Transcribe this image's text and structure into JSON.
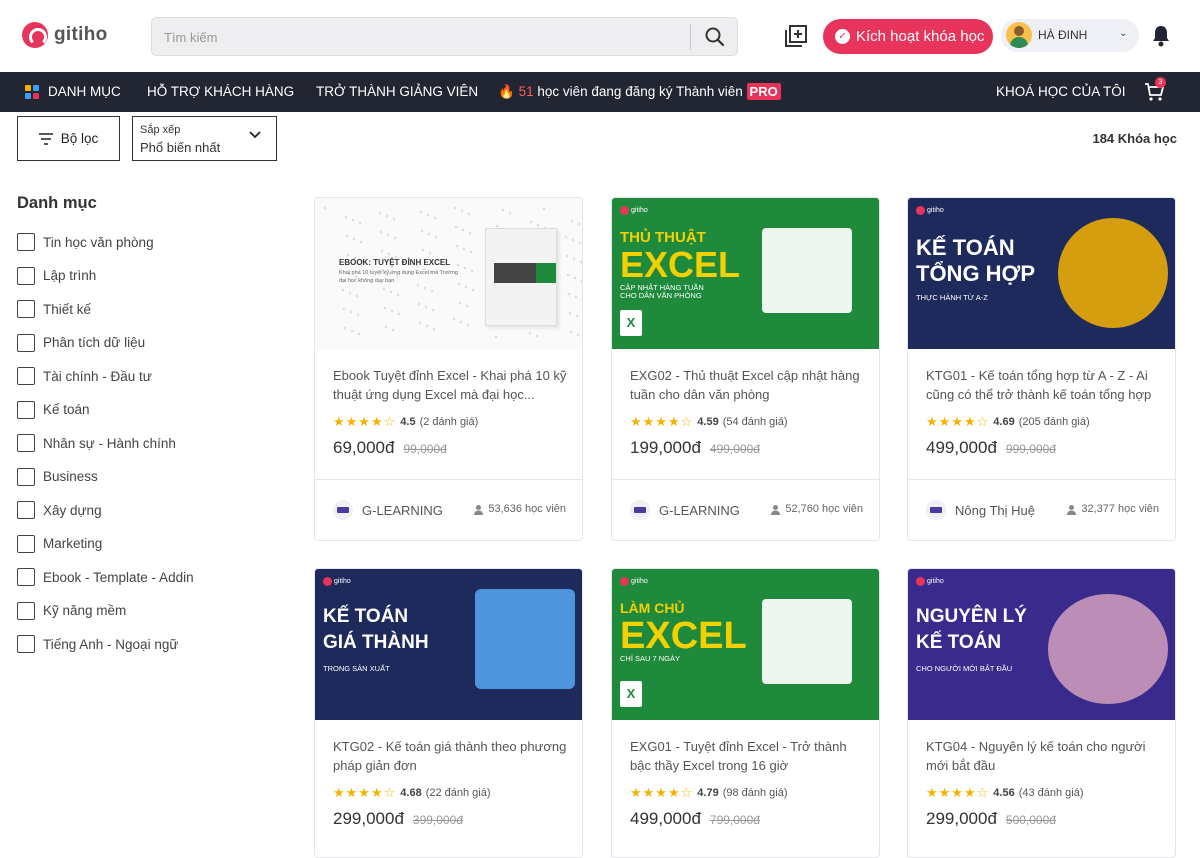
{
  "header": {
    "logo_text": "gitiho",
    "search_placeholder": "Tìm kiếm",
    "activate_label": "Kích hoạt khóa học",
    "user_name": "HÀ ĐINH"
  },
  "nav": {
    "category": "DANH MỤC",
    "support": "HỖ TRỢ KHÁCH HÀNG",
    "teacher": "TRỞ THÀNH GIẢNG VIÊN",
    "promo_count": "51",
    "promo_text": "học viên đang đăng ký Thành viên",
    "promo_badge": "PRO",
    "my_courses": "KHOÁ HỌC CỦA TÔI",
    "cart_count": "3"
  },
  "filters": {
    "filter_label": "Bộ lọc",
    "sort_label": "Sắp xếp",
    "sort_value": "Phổ biến nhất",
    "total": "184 Khóa học"
  },
  "sidebar": {
    "title": "Danh mục",
    "items": [
      "Tin học văn phòng",
      "Lập trình",
      "Thiết kế",
      "Phân tích dữ liệu",
      "Tài chính - Đầu tư",
      "Kế toán",
      "Nhân sự - Hành chính",
      "Business",
      "Xây dựng",
      "Marketing",
      "Ebook - Template - Addin",
      "Kỹ năng mềm",
      "Tiếng Anh - Ngoại ngữ"
    ]
  },
  "courses": [
    {
      "title": "Ebook Tuyệt đỉnh Excel - Khai phá 10 kỹ thuật ứng dụng Excel mà đại học...",
      "rating": "4.5",
      "reviews": "(2 đánh giá)",
      "price": "69,000đ",
      "old_price": "99,000đ",
      "author": "G-LEARNING",
      "students": "53,636 học viên",
      "thumb_line1": "EBOOK: TUYỆT ĐỈNH EXCEL",
      "thumb_line2": "Khai phá 10 tuyệt kỹ ứng dụng Excel mà Trường đại học không dạy bạn"
    },
    {
      "title": "EXG02 - Thủ thuật Excel cập nhật hàng tuần cho dân văn phòng",
      "rating": "4.59",
      "reviews": "(54 đánh giá)",
      "price": "199,000đ",
      "old_price": "499,000đ",
      "author": "G-LEARNING",
      "students": "52,760 học viên",
      "thumb_line1": "THỦ THUẬT",
      "thumb_line2": "EXCEL",
      "thumb_line3": "CẬP NHẬT HÀNG TUẦN CHO DÂN VĂN PHÒNG"
    },
    {
      "title": "KTG01 - Kế toán tổng hợp từ A - Z - Ai cũng có thể trở thành kế toán tổng hợp",
      "rating": "4.69",
      "reviews": "(205 đánh giá)",
      "price": "499,000đ",
      "old_price": "999,000đ",
      "author": "Nông Thị Huệ",
      "students": "32,377 học viên",
      "thumb_line1": "KẾ TOÁN",
      "thumb_line2": "TỔNG HỢP",
      "thumb_line3": "THỰC HÀNH TỪ A-Z"
    },
    {
      "title": "KTG02 - Kế toán giá thành theo phương pháp giản đơn",
      "rating": "4.68",
      "reviews": "(22 đánh giá)",
      "price": "299,000đ",
      "old_price": "399,000đ",
      "thumb_line1": "KẾ TOÁN",
      "thumb_line2": "GIÁ THÀNH",
      "thumb_line3": "TRONG SẢN XUẤT"
    },
    {
      "title": "EXG01 - Tuyệt đỉnh Excel - Trở thành bậc thầy Excel trong 16 giờ",
      "rating": "4.79",
      "reviews": "(98 đánh giá)",
      "price": "499,000đ",
      "old_price": "799,000đ",
      "thumb_line1": "LÀM CHỦ",
      "thumb_line2": "EXCEL",
      "thumb_line3": "CHỈ SAU 7 NGÀY"
    },
    {
      "title": "KTG04 - Nguyên lý kế toán cho người mới bắt đầu",
      "rating": "4.56",
      "reviews": "(43 đánh giá)",
      "price": "299,000đ",
      "old_price": "500,000đ",
      "thumb_line1": "NGUYÊN LÝ",
      "thumb_line2": "KẾ TOÁN",
      "thumb_line3": "CHO NGƯỜI MỚI BẮT ĐẦU"
    }
  ],
  "colors": {
    "brand": "#e8345b",
    "nav_bg": "#222633",
    "star": "#f5b301",
    "excel_green": "#1f8a3c",
    "navy": "#1f2a5c",
    "purple": "#3a2a8c"
  }
}
